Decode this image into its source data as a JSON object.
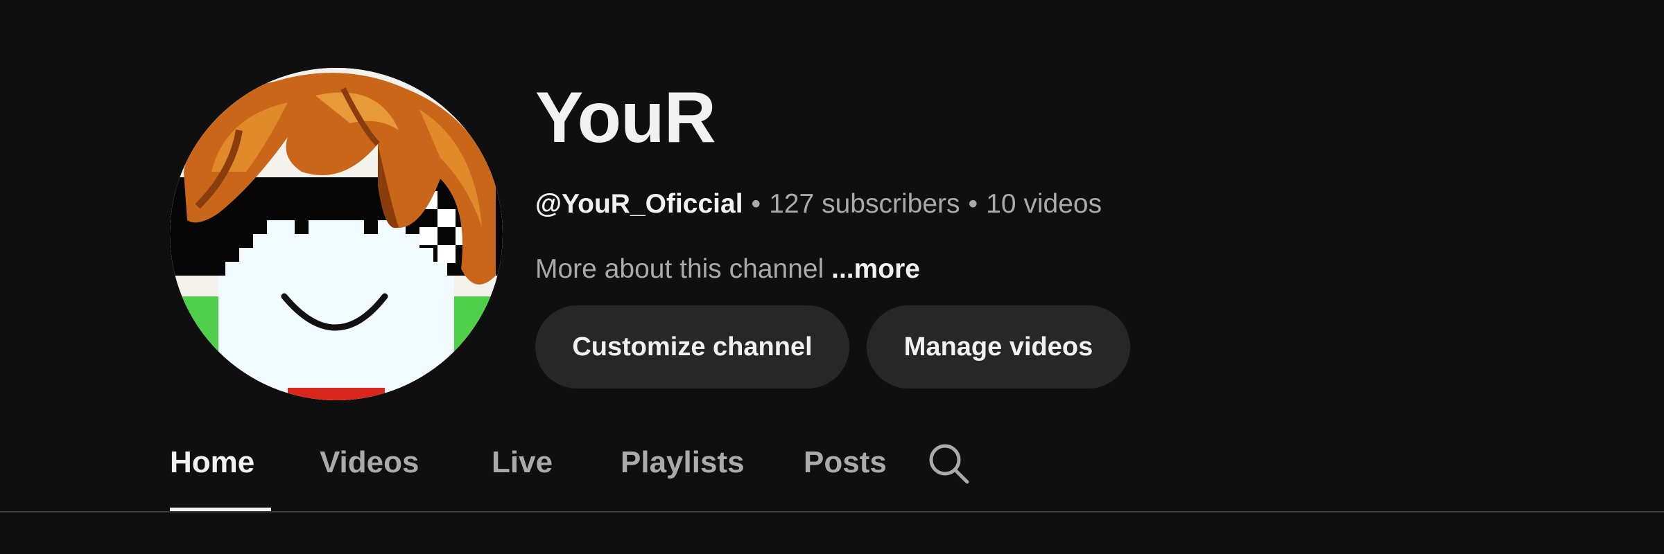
{
  "channel": {
    "name": "YouR",
    "handle": "@YouR_Oficcial",
    "separator": "•",
    "subscribers": "127 subscribers",
    "videos": "10 videos",
    "description": "More about this channel",
    "more_label": "...more"
  },
  "actions": {
    "customize_label": "Customize channel",
    "manage_label": "Manage videos"
  },
  "tabs": [
    {
      "label": "Home",
      "active": true
    },
    {
      "label": "Videos",
      "active": false
    },
    {
      "label": "Live",
      "active": false
    },
    {
      "label": "Playlists",
      "active": false
    },
    {
      "label": "Posts",
      "active": false
    }
  ],
  "icons": {
    "search": "search-icon",
    "avatar": "avatar-image"
  },
  "colors": {
    "background": "#0f0f0f",
    "text_primary": "#f1f1f1",
    "text_secondary": "#aaaaaa",
    "button_bg": "#272727",
    "divider": "#3f3f3f"
  }
}
